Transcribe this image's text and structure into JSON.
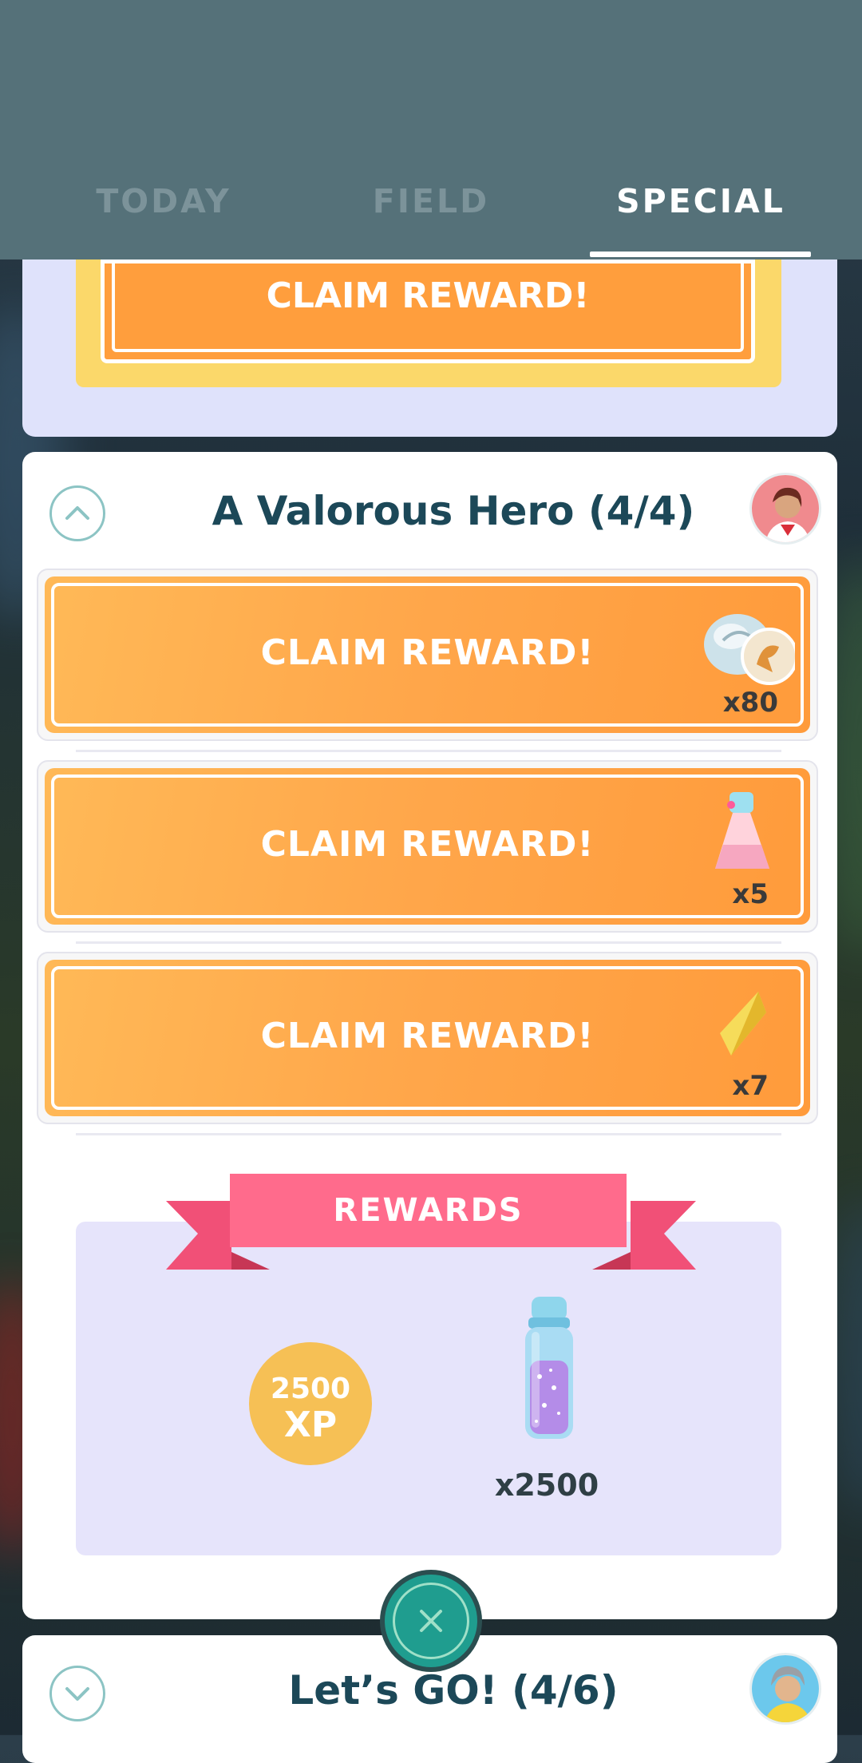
{
  "tabs": [
    {
      "label": "TODAY",
      "active": false
    },
    {
      "label": "FIELD",
      "active": false
    },
    {
      "label": "SPECIAL",
      "active": true
    }
  ],
  "previous_card": {
    "button_label": "CLAIM REWARD!"
  },
  "card": {
    "title": "A Valorous Hero (4/4)",
    "expanded": true,
    "tasks": [
      {
        "button_label": "CLAIM REWARD!",
        "reward_icon": "dragonite-candy-icon",
        "reward_count": "x80"
      },
      {
        "button_label": "CLAIM REWARD!",
        "reward_icon": "incense-icon",
        "reward_count": "x5"
      },
      {
        "button_label": "CLAIM REWARD!",
        "reward_icon": "rare-candy-icon",
        "reward_count": "x7"
      }
    ],
    "rewards": {
      "label": "REWARDS",
      "xp_amount": "2500",
      "xp_unit": "XP",
      "stardust_count": "x2500"
    }
  },
  "next_card": {
    "title": "Let’s GO! (4/6)",
    "expanded": false
  },
  "colors": {
    "header": "#557179",
    "orange": "#ffa64a",
    "ribbon": "#ff6b8c",
    "title": "#1c4858",
    "close": "#1f9d8f"
  }
}
